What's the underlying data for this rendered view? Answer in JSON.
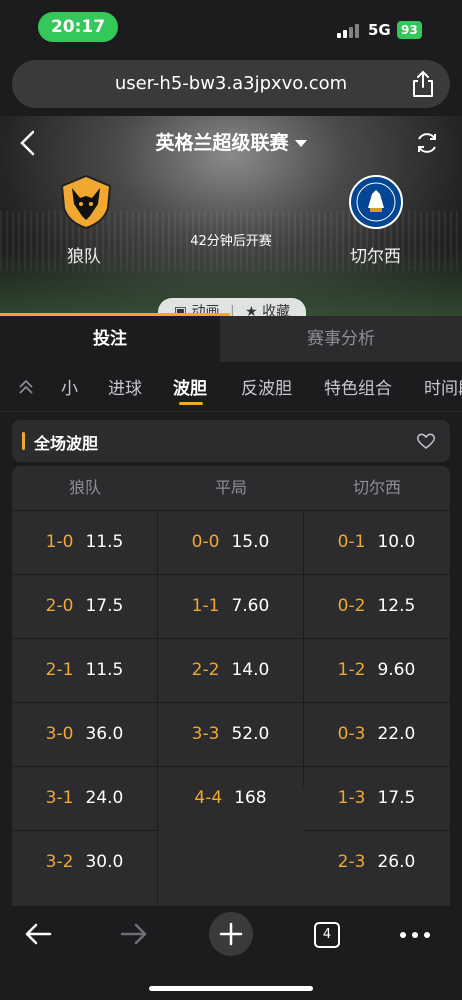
{
  "status": {
    "time": "20:17",
    "network": "5G",
    "battery": "93"
  },
  "browser": {
    "url": "user-h5-bw3.a3jpxvo.com"
  },
  "match": {
    "league": "英格兰超级联赛",
    "home_team": "狼队",
    "away_team": "切尔西",
    "kickoff": "42分钟后开赛",
    "actions": {
      "animation": "动画",
      "favorite": "收藏"
    }
  },
  "tabs": {
    "bet": "投注",
    "analysis": "赛事分析"
  },
  "subnav": {
    "items": [
      "小",
      "进球",
      "波胆",
      "反波胆",
      "特色组合",
      "时间段"
    ],
    "selected": "波胆"
  },
  "section": {
    "title": "全场波胆"
  },
  "odds": {
    "headers": [
      "狼队",
      "平局",
      "切尔西"
    ],
    "home": [
      {
        "score": "1-0",
        "odds": "11.5"
      },
      {
        "score": "2-0",
        "odds": "17.5"
      },
      {
        "score": "2-1",
        "odds": "11.5"
      },
      {
        "score": "3-0",
        "odds": "36.0"
      },
      {
        "score": "3-1",
        "odds": "24.0"
      },
      {
        "score": "3-2",
        "odds": "30.0"
      }
    ],
    "draw": [
      {
        "score": "0-0",
        "odds": "15.0"
      },
      {
        "score": "1-1",
        "odds": "7.60"
      },
      {
        "score": "2-2",
        "odds": "14.0"
      },
      {
        "score": "3-3",
        "odds": "52.0"
      },
      {
        "score": "4-4",
        "odds": "168"
      }
    ],
    "away": [
      {
        "score": "0-1",
        "odds": "10.0"
      },
      {
        "score": "0-2",
        "odds": "12.5"
      },
      {
        "score": "1-2",
        "odds": "9.60"
      },
      {
        "score": "0-3",
        "odds": "22.0"
      },
      {
        "score": "1-3",
        "odds": "17.5"
      },
      {
        "score": "2-3",
        "odds": "26.0"
      }
    ]
  },
  "toolbar": {
    "tab_count": "4"
  },
  "colors": {
    "accent": "#f0a830",
    "status_pill": "#34c759",
    "background": "#1c1c1e"
  }
}
